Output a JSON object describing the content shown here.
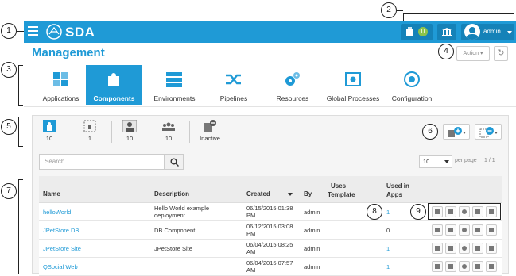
{
  "app": {
    "name": "SDA"
  },
  "topbar": {
    "notification_count": "0",
    "user_name": "admin"
  },
  "page": {
    "title": "Management",
    "action_label": "Action"
  },
  "nav": {
    "items": [
      {
        "label": "Applications",
        "icon": "puzzle-icon"
      },
      {
        "label": "Components",
        "icon": "puzzle-piece-icon"
      },
      {
        "label": "Environments",
        "icon": "server-stack-icon"
      },
      {
        "label": "Pipelines",
        "icon": "shuffle-icon"
      },
      {
        "label": "Resources",
        "icon": "gears-icon"
      },
      {
        "label": "Global Processes",
        "icon": "process-icon"
      },
      {
        "label": "Configuration",
        "icon": "config-gear-icon"
      }
    ],
    "active": "Components"
  },
  "filters": [
    {
      "count": "10",
      "label": ""
    },
    {
      "count": "1",
      "label": ""
    },
    {
      "count": "10",
      "label": ""
    },
    {
      "count": "10",
      "label": ""
    },
    {
      "count": "",
      "label": "Inactive"
    }
  ],
  "search": {
    "placeholder": "Search"
  },
  "pagination": {
    "per_page_value": "10",
    "per_page_label": "per page",
    "pages": "1 / 1"
  },
  "table": {
    "headers": {
      "name": "Name",
      "description": "Description",
      "created": "Created",
      "by": "By",
      "uses_template_1": "Uses",
      "uses_template_2": "Template",
      "used_in_apps_1": "Used in",
      "used_in_apps_2": "Apps"
    },
    "rows": [
      {
        "name": "helloWorld",
        "desc1": "Hello World example",
        "desc2": "deployment",
        "created1": "06/15/2015 01:38",
        "created2": "PM",
        "by": "admin",
        "used": "1"
      },
      {
        "name": "JPetStore DB",
        "desc1": "DB Component",
        "desc2": "",
        "created1": "06/12/2015 03:08",
        "created2": "PM",
        "by": "admin",
        "used": "0"
      },
      {
        "name": "JPetStore Site",
        "desc1": "JPetStore Site",
        "desc2": "",
        "created1": "06/04/2015 08:25",
        "created2": "AM",
        "by": "admin",
        "used": "1"
      },
      {
        "name": "QSocial Web",
        "desc1": "",
        "desc2": "",
        "created1": "06/04/2015 07:57",
        "created2": "AM",
        "by": "admin",
        "used": "1"
      }
    ]
  },
  "callouts": [
    "1",
    "2",
    "3",
    "4",
    "5",
    "6",
    "7",
    "8",
    "9"
  ],
  "colors": {
    "brand": "#1f9ad6",
    "topbar_button": "#1582b8",
    "badge": "#8bc34a"
  }
}
